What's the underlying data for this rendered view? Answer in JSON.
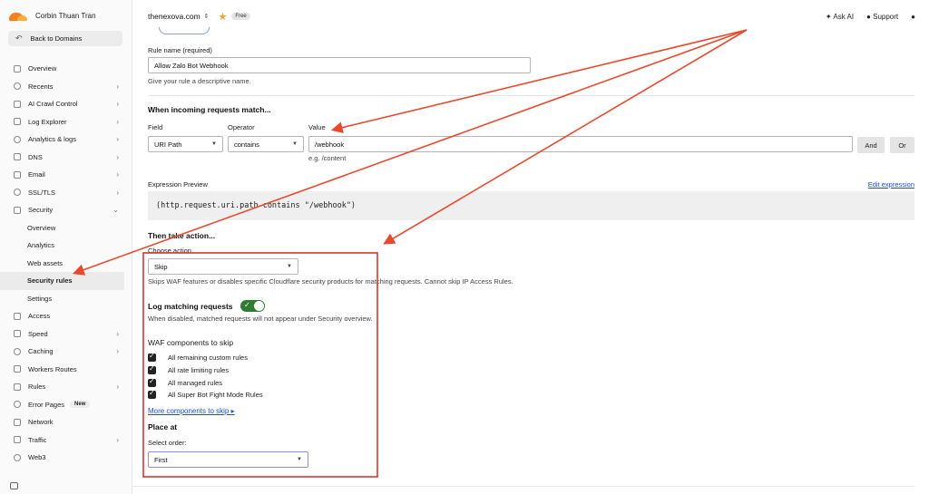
{
  "account": {
    "name": "Corbin Thuan Tran"
  },
  "sidebar": {
    "back_label": "Back to Domains",
    "items": [
      {
        "label": "Overview",
        "chevron": false
      },
      {
        "label": "Recents",
        "chevron": true
      },
      {
        "label": "AI Crawl Control",
        "chevron": true
      },
      {
        "label": "Log Explorer",
        "chevron": true
      },
      {
        "label": "Analytics & logs",
        "chevron": true
      },
      {
        "label": "DNS",
        "chevron": true
      },
      {
        "label": "Email",
        "chevron": true
      },
      {
        "label": "SSL/TLS",
        "chevron": true
      },
      {
        "label": "Security",
        "chevron": true,
        "expanded": true
      },
      {
        "label": "Overview",
        "sub": true
      },
      {
        "label": "Analytics",
        "sub": true
      },
      {
        "label": "Web assets",
        "sub": true
      },
      {
        "label": "Security rules",
        "sub": true,
        "active": true
      },
      {
        "label": "Settings",
        "sub": true
      },
      {
        "label": "Access",
        "chevron": false
      },
      {
        "label": "Speed",
        "chevron": true
      },
      {
        "label": "Caching",
        "chevron": true
      },
      {
        "label": "Workers Routes",
        "chevron": false
      },
      {
        "label": "Rules",
        "chevron": true
      },
      {
        "label": "Error Pages",
        "chevron": false,
        "badge": "New"
      },
      {
        "label": "Network",
        "chevron": false
      },
      {
        "label": "Traffic",
        "chevron": true
      },
      {
        "label": "Web3",
        "chevron": false
      }
    ]
  },
  "topbar": {
    "domain": "thenexova.com",
    "plan_badge": "Free",
    "ask_ai": "Ask AI",
    "support": "Support"
  },
  "form": {
    "rule_name_label": "Rule name (required)",
    "rule_name_value": "Allow Zalo Bot Webhook",
    "rule_name_help": "Give your rule a descriptive name.",
    "match_heading": "When incoming requests match...",
    "field_label": "Field",
    "operator_label": "Operator",
    "value_label": "Value",
    "field_value": "URI Path",
    "operator_value": "contains",
    "value_value": "/webhook",
    "value_hint": "e.g. /content",
    "and_label": "And",
    "or_label": "Or",
    "expr_label": "Expression Preview",
    "edit_expression": "Edit expression",
    "expression": "(http.request.uri.path contains \"/webhook\")",
    "action_heading": "Then take action...",
    "choose_action_label": "Choose action",
    "action_value": "Skip",
    "action_help": "Skips WAF features or disables specific Cloudflare security products for matching requests. Cannot skip IP Access Rules.",
    "log_label": "Log matching requests",
    "log_help": "When disabled, matched requests will not appear under Security overview.",
    "waf_heading": "WAF components to skip",
    "waf_items": [
      "All remaining custom rules",
      "All rate limiting rules",
      "All managed rules",
      "All Super Bot Fight Mode Rules"
    ],
    "more_components": "More components to skip",
    "place_heading": "Place at",
    "select_order_label": "Select order:",
    "order_value": "First"
  },
  "annotation": {
    "arrow_color": "#e8492e",
    "box_color": "#d9362b"
  }
}
